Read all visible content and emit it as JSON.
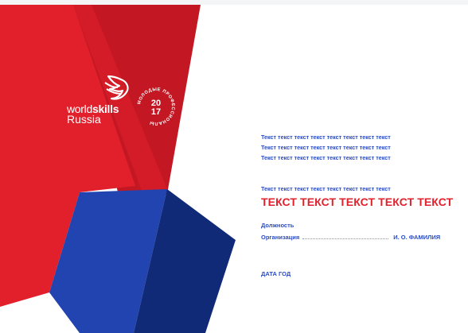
{
  "logo": {
    "brand_world": "world",
    "brand_skills": "skills",
    "brand_region": "Russia",
    "badge_arc_text": "МОЛОДЫЕ ПРОФЕССИОНАЛЫ",
    "badge_year_top": "20",
    "badge_year_bottom": "17"
  },
  "body_text": {
    "line1": "Текст текст текст текст текст текст текст текст",
    "line2": "Текст текст текст текст текст текст текст текст",
    "line3": "Текст текст текст текст текст текст текст текст",
    "line4": "Текст текст текст текст текст текст текст текст",
    "headline": "ТЕКСТ ТЕКСТ ТЕКСТ ТЕКСТ ТЕКСТ"
  },
  "signature": {
    "position_label": "Должность",
    "organization_label": "Организация",
    "name_placeholder": "И. О. ФАМИЛИЯ",
    "date_placeholder": "ДАТА ГОД"
  },
  "colors": {
    "red_primary": "#e2202c",
    "red_dark": "#c31823",
    "blue_primary": "#2244b0",
    "blue_dark": "#112a78",
    "text_blue": "#2a4cc4",
    "text_red": "#e0202b"
  }
}
